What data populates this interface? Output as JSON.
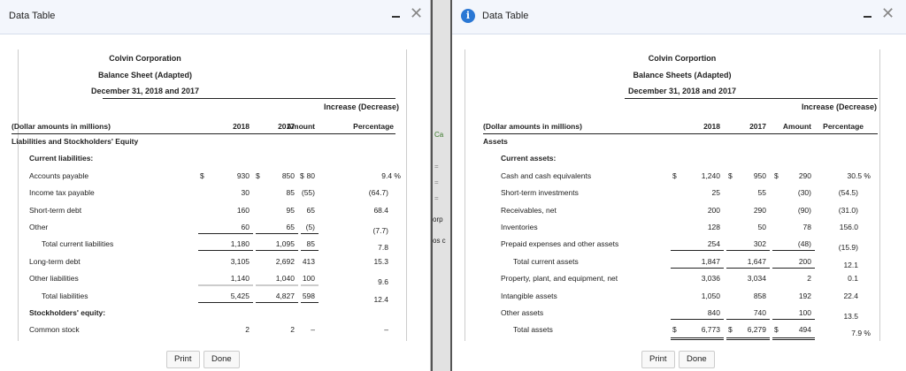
{
  "left": {
    "window_title": "Data Table",
    "company": "Colvin Corporation",
    "statement": "Balance Sheet (Adapted)",
    "date": "December 31, 2018 and 2017",
    "inc_header": "Increase (Decrease)",
    "columns": {
      "label": "(Dollar amounts in millions)",
      "y2018": "2018",
      "y2017": "2017",
      "amount": "Amount",
      "pct": "Percentage"
    },
    "rows": [
      {
        "label": "Liabilities and Stockholders' Equity",
        "level": 0,
        "bold": true
      },
      {
        "label": "Current liabilities:",
        "level": 1,
        "bold": true
      },
      {
        "label": "Accounts payable",
        "level": 1,
        "dollar": true,
        "v2018": "930",
        "v2017": "850",
        "amt": "80",
        "pct": "9.4 %"
      },
      {
        "label": "Income tax payable",
        "level": 1,
        "v2018": "30",
        "v2017": "85",
        "amt": "(55)",
        "pct": "(64.7)"
      },
      {
        "label": "Short-term debt",
        "level": 1,
        "v2018": "160",
        "v2017": "95",
        "amt": "65",
        "pct": "68.4"
      },
      {
        "label": "Other",
        "level": 1,
        "v2018": "60",
        "v2017": "65",
        "amt": "(5)",
        "pct": "(7.7)",
        "under": "single"
      },
      {
        "label": "Total current liabilities",
        "level": 2,
        "v2018": "1,180",
        "v2017": "1,095",
        "amt": "85",
        "pct": "7.8",
        "under": "single"
      },
      {
        "label": "Long-term debt",
        "level": 1,
        "v2018": "3,105",
        "v2017": "2,692",
        "amt": "413",
        "pct": "15.3"
      },
      {
        "label": "Other liabilities",
        "level": 1,
        "v2018": "1,140",
        "v2017": "1,040",
        "amt": "100",
        "pct": "9.6",
        "under": "light"
      },
      {
        "label": "Total liabilities",
        "level": 2,
        "v2018": "5,425",
        "v2017": "4,827",
        "amt": "598",
        "pct": "12.4",
        "under": "single"
      },
      {
        "label": "Stockholders' equity:",
        "level": 1,
        "bold": true
      },
      {
        "label": "Common stock",
        "level": 1,
        "v2018": "2",
        "v2017": "2",
        "amt": "–",
        "pct": "–"
      }
    ],
    "print": "Print",
    "done": "Done"
  },
  "right": {
    "window_title": "Data Table",
    "company": "Colvin Corportion",
    "statement": "Balance Sheets (Adapted)",
    "date": "December 31, 2018 and 2017",
    "inc_header": "Increase (Decrease)",
    "columns": {
      "label": "(Dollar amounts in millions)",
      "y2018": "2018",
      "y2017": "2017",
      "amount": "Amount",
      "pct": "Percentage"
    },
    "rows": [
      {
        "label": "Assets",
        "level": 0,
        "bold": true
      },
      {
        "label": "Current assets:",
        "level": 1,
        "bold": true
      },
      {
        "label": "Cash and cash equivalents",
        "level": 1,
        "dollar": true,
        "v2018": "1,240",
        "v2017": "950",
        "amt": "290",
        "pct": "30.5 %"
      },
      {
        "label": "Short-term investments",
        "level": 1,
        "v2018": "25",
        "v2017": "55",
        "amt": "(30)",
        "pct": "(54.5)"
      },
      {
        "label": "Receivables, net",
        "level": 1,
        "v2018": "200",
        "v2017": "290",
        "amt": "(90)",
        "pct": "(31.0)"
      },
      {
        "label": "Inventories",
        "level": 1,
        "v2018": "128",
        "v2017": "50",
        "amt": "78",
        "pct": "156.0"
      },
      {
        "label": "Prepaid expenses and other assets",
        "level": 1,
        "v2018": "254",
        "v2017": "302",
        "amt": "(48)",
        "pct": "(15.9)",
        "under": "single"
      },
      {
        "label": "Total current assets",
        "level": 2,
        "v2018": "1,847",
        "v2017": "1,647",
        "amt": "200",
        "pct": "12.1",
        "under": "single"
      },
      {
        "label": "Property, plant, and equipment, net",
        "level": 1,
        "v2018": "3,036",
        "v2017": "3,034",
        "amt": "2",
        "pct": "0.1"
      },
      {
        "label": "Intangible assets",
        "level": 1,
        "v2018": "1,050",
        "v2017": "858",
        "amt": "192",
        "pct": "22.4"
      },
      {
        "label": "Other assets",
        "level": 1,
        "v2018": "840",
        "v2017": "740",
        "amt": "100",
        "pct": "13.5",
        "under": "single"
      },
      {
        "label": "Total assets",
        "level": 2,
        "dollar": true,
        "v2018": "6,773",
        "v2017": "6,279",
        "amt": "494",
        "pct": "7.9 %",
        "under": "double"
      }
    ],
    "print": "Print",
    "done": "Done"
  },
  "background": {
    "fragments": [
      "Ca",
      "orp",
      "os c"
    ]
  }
}
